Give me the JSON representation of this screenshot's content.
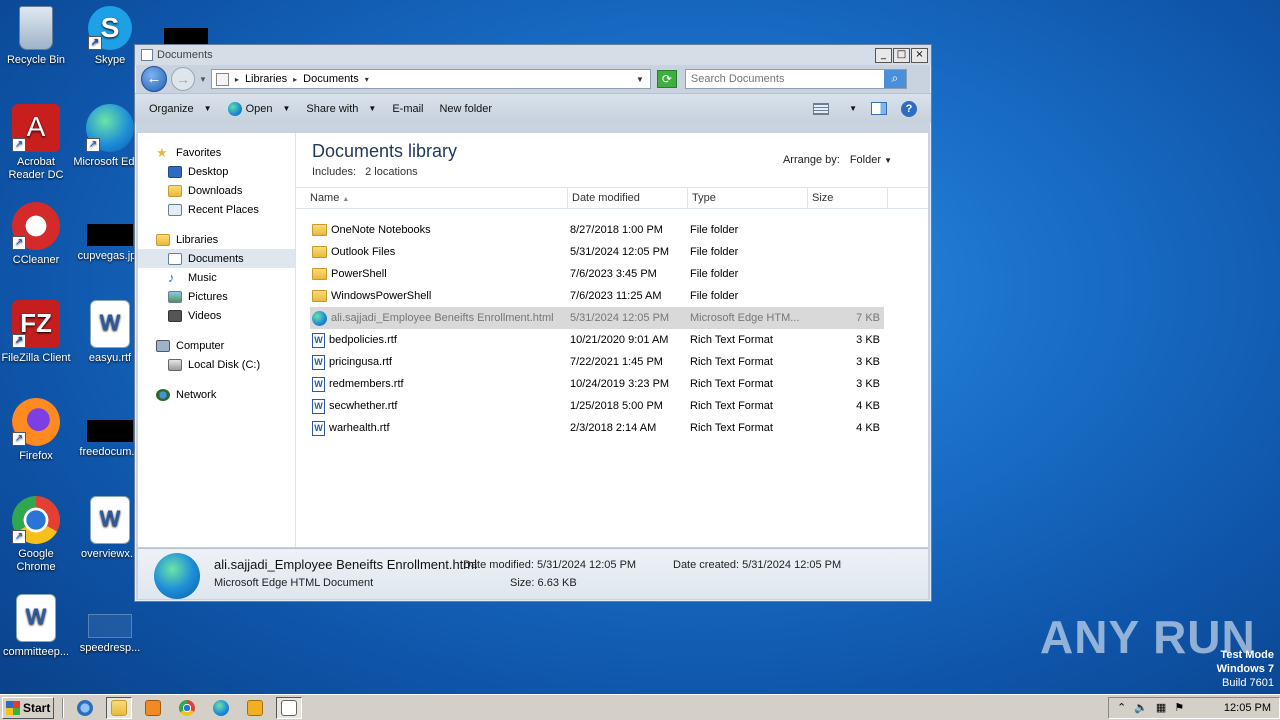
{
  "desktop": {
    "icons": [
      {
        "label": "Recycle Bin"
      },
      {
        "label": "Skype"
      },
      {
        "label": "Acrobat Reader DC"
      },
      {
        "label": "Microsoft Edge"
      },
      {
        "label": "CCleaner"
      },
      {
        "label": "cupvegas.jpg"
      },
      {
        "label": "FileZilla Client"
      },
      {
        "label": "easyu.rtf"
      },
      {
        "label": "Firefox"
      },
      {
        "label": "freedocum..."
      },
      {
        "label": "Google Chrome"
      },
      {
        "label": "overviewx..."
      },
      {
        "label": "committeep..."
      },
      {
        "label": "speedresp..."
      }
    ]
  },
  "window": {
    "title": "Documents",
    "minimize": "_",
    "maximize": "□",
    "close": "×"
  },
  "address": {
    "crumbs": [
      "Libraries",
      "Documents"
    ],
    "search_placeholder": "Search Documents"
  },
  "toolbar": {
    "organize": "Organize",
    "open": "Open",
    "share_with": "Share with",
    "email": "E-mail",
    "new_folder": "New folder"
  },
  "navpane": {
    "favorites": "Favorites",
    "desktop": "Desktop",
    "downloads": "Downloads",
    "recent_places": "Recent Places",
    "libraries": "Libraries",
    "documents": "Documents",
    "music": "Music",
    "pictures": "Pictures",
    "videos": "Videos",
    "computer": "Computer",
    "local_disk": "Local Disk (C:)",
    "network": "Network"
  },
  "library": {
    "title": "Documents library",
    "includes_label": "Includes:",
    "includes_value": "2 locations",
    "arrange_label": "Arrange by:",
    "arrange_value": "Folder"
  },
  "columns": {
    "name": "Name",
    "date": "Date modified",
    "type": "Type",
    "size": "Size"
  },
  "files": [
    {
      "name": "OneNote Notebooks",
      "date": "8/27/2018 1:00 PM",
      "type": "File folder",
      "size": "",
      "icon": "folder-icon"
    },
    {
      "name": "Outlook Files",
      "date": "5/31/2024 12:05 PM",
      "type": "File folder",
      "size": "",
      "icon": "folder-icon"
    },
    {
      "name": "PowerShell",
      "date": "7/6/2023 3:45 PM",
      "type": "File folder",
      "size": "",
      "icon": "folder-icon"
    },
    {
      "name": "WindowsPowerShell",
      "date": "7/6/2023 11:25 AM",
      "type": "File folder",
      "size": "",
      "icon": "folder-icon"
    },
    {
      "name": "ali.sajjadi_Employee Beneifts Enrollment.html",
      "date": "5/31/2024 12:05 PM",
      "type": "Microsoft Edge HTM...",
      "size": "7 KB",
      "icon": "edge-icon"
    },
    {
      "name": "bedpolicies.rtf",
      "date": "10/21/2020 9:01 AM",
      "type": "Rich Text Format",
      "size": "3 KB",
      "icon": "rtf-icon"
    },
    {
      "name": "pricingusa.rtf",
      "date": "7/22/2021 1:45 PM",
      "type": "Rich Text Format",
      "size": "3 KB",
      "icon": "rtf-icon"
    },
    {
      "name": "redmembers.rtf",
      "date": "10/24/2019 3:23 PM",
      "type": "Rich Text Format",
      "size": "3 KB",
      "icon": "rtf-icon"
    },
    {
      "name": "secwhether.rtf",
      "date": "1/25/2018 5:00 PM",
      "type": "Rich Text Format",
      "size": "4 KB",
      "icon": "rtf-icon"
    },
    {
      "name": "warhealth.rtf",
      "date": "2/3/2018 2:14 AM",
      "type": "Rich Text Format",
      "size": "4 KB",
      "icon": "rtf-icon"
    }
  ],
  "details": {
    "name": "ali.sajjadi_Employee Beneifts Enrollment.html",
    "type": "Microsoft Edge HTML Document",
    "modified_label": "Date modified:",
    "modified_value": "5/31/2024 12:05 PM",
    "size_label": "Size:",
    "size_value": "6.63 KB",
    "created_label": "Date created:",
    "created_value": "5/31/2024 12:05 PM"
  },
  "watermark": "ANY RUN",
  "testmode": {
    "line1": "Test Mode",
    "line2": "Windows 7",
    "line3": "Build 7601"
  },
  "taskbar": {
    "start": "Start",
    "clock": "12:05 PM"
  }
}
